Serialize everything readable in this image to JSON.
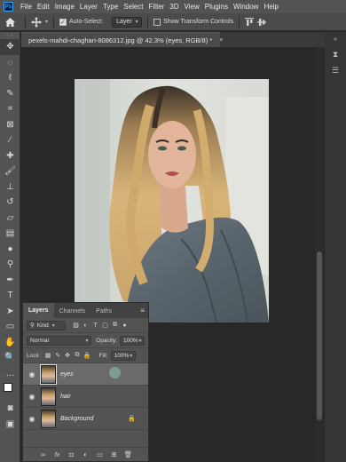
{
  "menubar": {
    "logo": "Ps",
    "items": [
      "File",
      "Edit",
      "Image",
      "Layer",
      "Type",
      "Select",
      "Filter",
      "3D",
      "View",
      "Plugins",
      "Window",
      "Help"
    ]
  },
  "options": {
    "auto_select_label": "Auto-Select:",
    "auto_select_value": "Layer",
    "show_transform_label": "Show Transform Controls"
  },
  "document": {
    "tab_title": "pexels-mahdi-chaghari-8086312.jpg @ 42.3% (eyes, RGB/8) *",
    "close": "×"
  },
  "layers_panel": {
    "tabs": [
      "Layers",
      "Channels",
      "Paths"
    ],
    "filter_value": "Kind",
    "blend_mode": "Normal",
    "opacity_label": "Opacity:",
    "opacity_value": "100%",
    "lock_label": "Lock:",
    "fill_label": "Fill:",
    "fill_value": "100%",
    "layers": [
      {
        "name": "eyes"
      },
      {
        "name": "hair"
      },
      {
        "name": "Background"
      }
    ],
    "footer_fx": "fx"
  },
  "colors": {
    "menubar": "#535353",
    "panel": "#535353",
    "canvas_bg": "#282828",
    "selected_layer": "#6a6a6a"
  },
  "icons": [
    "home-icon",
    "move-icon",
    "gear-icon",
    "eye-icon",
    "lock-icon",
    "link-icon",
    "trash-icon"
  ]
}
